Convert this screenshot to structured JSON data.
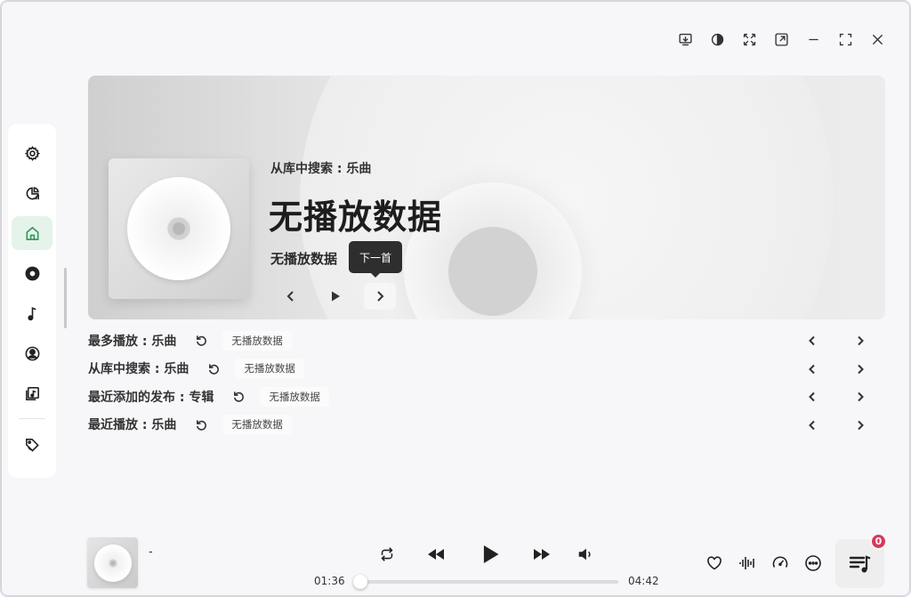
{
  "window": {
    "controls": [
      "download-icon",
      "contrast-icon",
      "mini-player-icon",
      "popout-icon",
      "minimize-icon",
      "maximize-icon",
      "close-icon"
    ]
  },
  "sidebar": {
    "items": [
      {
        "name": "settings",
        "icon": "gear-icon",
        "active": false
      },
      {
        "name": "stats",
        "icon": "chart-icon",
        "active": false
      },
      {
        "name": "home",
        "icon": "home-icon",
        "active": true
      },
      {
        "name": "albums",
        "icon": "disc-icon",
        "active": false
      },
      {
        "name": "tracks",
        "icon": "music-note-icon",
        "active": false
      },
      {
        "name": "artists",
        "icon": "user-icon",
        "active": false
      },
      {
        "name": "library",
        "icon": "library-icon",
        "active": false
      },
      {
        "name": "tags",
        "icon": "tag-icon",
        "active": false
      }
    ],
    "accent": "#2f9a5a"
  },
  "hero": {
    "subtitle": "从库中搜索 : 乐曲",
    "title": "无播放数据",
    "artist": "无播放数据",
    "tooltip": "下一首"
  },
  "sections": [
    {
      "title": "最多播放 : 乐曲",
      "chip": "无播放数据"
    },
    {
      "title": "从库中搜索 : 乐曲",
      "chip": "无播放数据"
    },
    {
      "title": "最近添加的发布 : 专辑",
      "chip": "无播放数据"
    },
    {
      "title": "最近播放 : 乐曲",
      "chip": "无播放数据"
    }
  ],
  "player": {
    "track": "-",
    "current_time": "01:36",
    "total_time": "04:42",
    "progress": 0.0,
    "queue_count": "0",
    "badge_color": "#d8385a"
  }
}
